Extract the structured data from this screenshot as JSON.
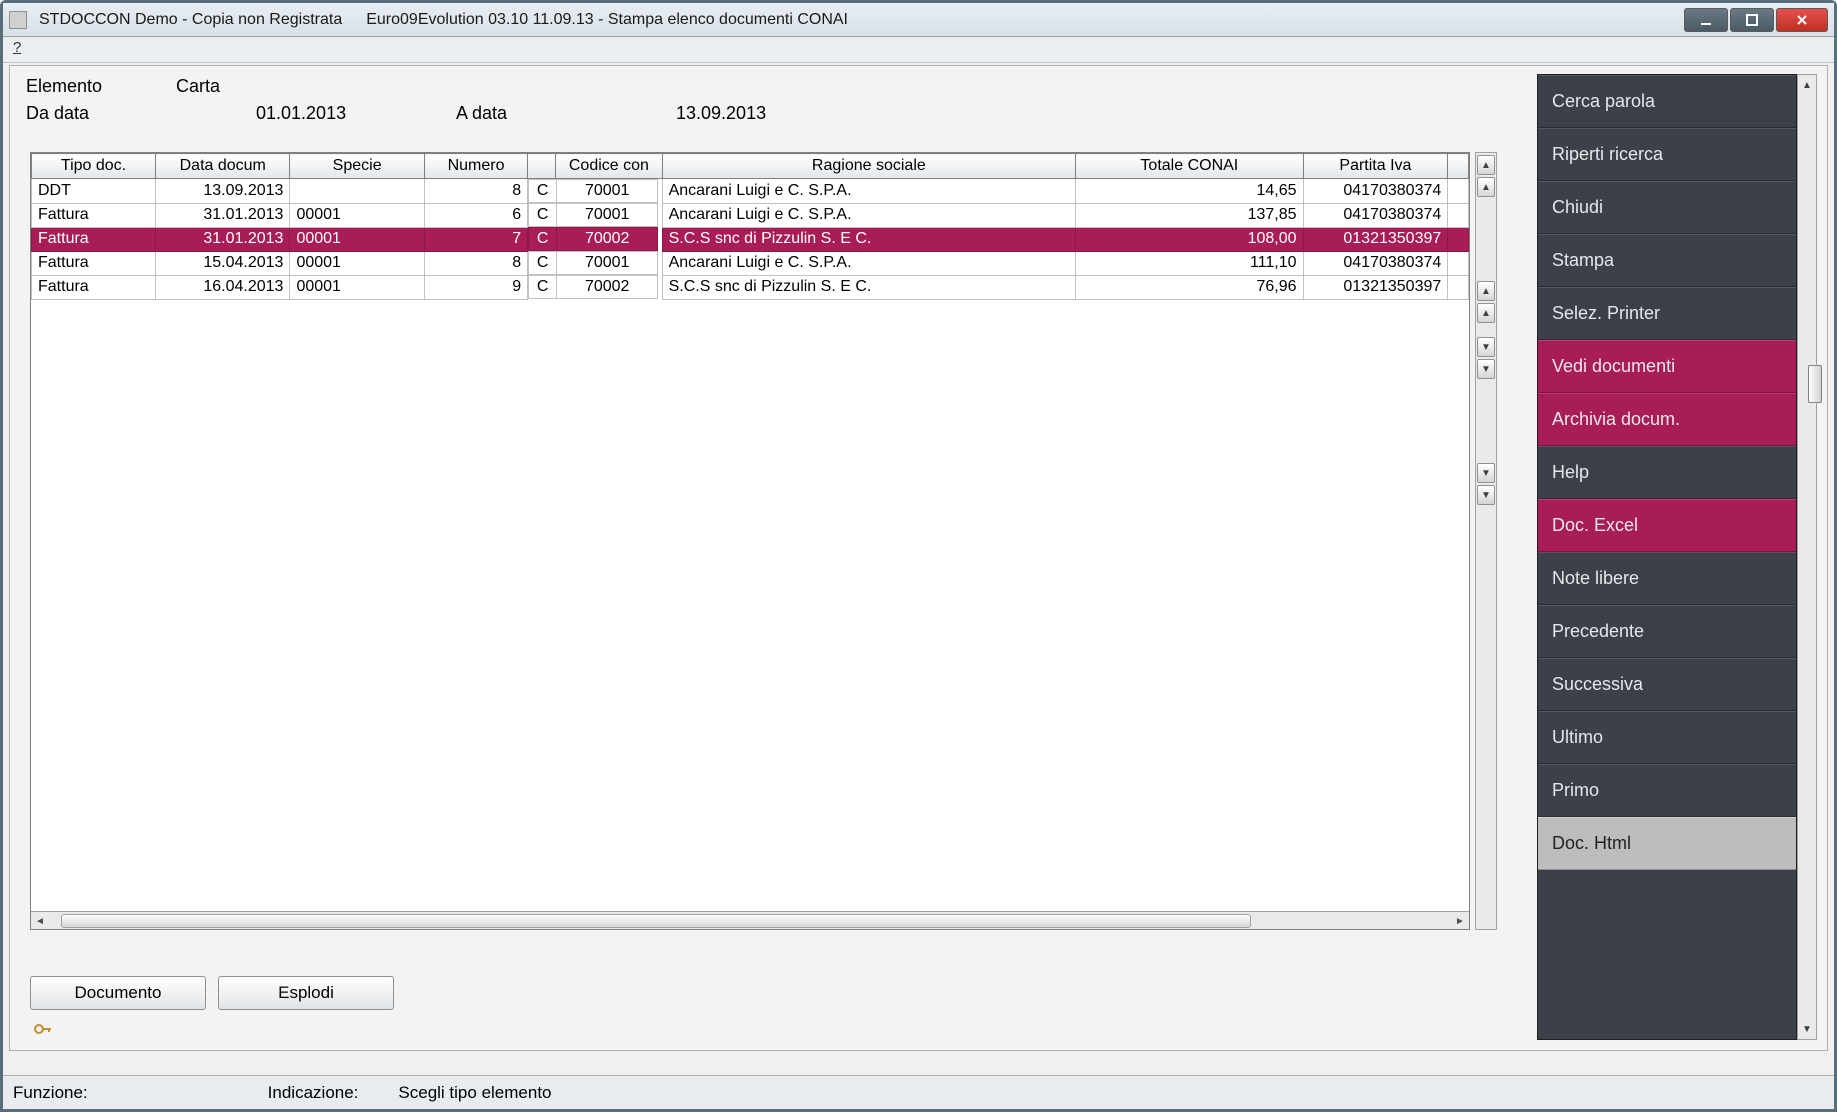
{
  "window": {
    "title1": "STDOCCON Demo - Copia non Registrata",
    "title2": "Euro09Evolution 03.10 11.09.13 -  Stampa elenco documenti CONAI",
    "menu_help": "?"
  },
  "header": {
    "elemento_label": "Elemento",
    "elemento_value": "Carta",
    "da_data_label": "Da data",
    "da_data_value": "01.01.2013",
    "a_data_label": "A data",
    "a_data_value": "13.09.2013"
  },
  "columns": {
    "tipo": "Tipo doc.",
    "data": "Data docum",
    "specie": "Specie",
    "numero": "Numero",
    "codice": "Codice con",
    "ragione": "Ragione sociale",
    "totale": "Totale CONAI",
    "piva": "Partita Iva"
  },
  "rows": [
    {
      "tipo": "DDT",
      "data": "13.09.2013",
      "specie": "",
      "numero": "8",
      "cod1": "C",
      "cod2": "70001",
      "ragione": "Ancarani Luigi e C. S.P.A.",
      "totale": "14,65",
      "piva": "04170380374",
      "selected": false
    },
    {
      "tipo": "Fattura",
      "data": "31.01.2013",
      "specie": "00001",
      "numero": "6",
      "cod1": "C",
      "cod2": "70001",
      "ragione": "Ancarani Luigi e C. S.P.A.",
      "totale": "137,85",
      "piva": "04170380374",
      "selected": false
    },
    {
      "tipo": "Fattura",
      "data": "31.01.2013",
      "specie": "00001",
      "numero": "7",
      "cod1": "C",
      "cod2": "70002",
      "ragione": "S.C.S snc di Pizzulin S. E C.",
      "totale": "108,00",
      "piva": "01321350397",
      "selected": true
    },
    {
      "tipo": "Fattura",
      "data": "15.04.2013",
      "specie": "00001",
      "numero": "8",
      "cod1": "C",
      "cod2": "70001",
      "ragione": "Ancarani Luigi e C. S.P.A.",
      "totale": "111,10",
      "piva": "04170380374",
      "selected": false
    },
    {
      "tipo": "Fattura",
      "data": "16.04.2013",
      "specie": "00001",
      "numero": "9",
      "cod1": "C",
      "cod2": "70002",
      "ragione": "S.C.S snc di Pizzulin S. E C.",
      "totale": "76,96",
      "piva": "01321350397",
      "selected": false
    }
  ],
  "side": [
    {
      "label": "Cerca parola",
      "style": "normal"
    },
    {
      "label": "Riperti ricerca",
      "style": "normal"
    },
    {
      "label": "Chiudi",
      "style": "normal"
    },
    {
      "label": "Stampa",
      "style": "normal"
    },
    {
      "label": "Selez. Printer",
      "style": "normal"
    },
    {
      "label": "Vedi documenti",
      "style": "accent"
    },
    {
      "label": "Archivia docum.",
      "style": "accent"
    },
    {
      "label": "Help",
      "style": "normal"
    },
    {
      "label": "Doc. Excel",
      "style": "accent"
    },
    {
      "label": "Note libere",
      "style": "normal"
    },
    {
      "label": "Precedente",
      "style": "normal"
    },
    {
      "label": "Successiva",
      "style": "normal"
    },
    {
      "label": "Ultimo",
      "style": "normal"
    },
    {
      "label": "Primo",
      "style": "normal"
    },
    {
      "label": "Doc. Html",
      "style": "light"
    }
  ],
  "bottom": {
    "documento": "Documento",
    "esplodi": "Esplodi"
  },
  "status": {
    "funzione_label": "Funzione:",
    "indicazione_label": "Indicazione:",
    "indicazione_value": "Scegli tipo elemento"
  }
}
